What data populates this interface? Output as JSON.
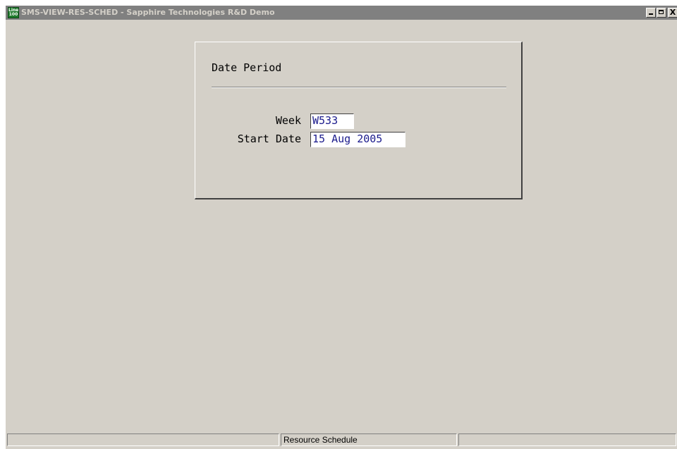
{
  "window": {
    "title": "SMS-VIEW-RES-SCHED - Sapphire Technologies R&D Demo",
    "icon": {
      "name": "line-100-app-icon",
      "text_top": "Line",
      "text_bottom": "100"
    },
    "controls": {
      "minimize_icon": "minimize-icon",
      "maximize_icon": "maximize-icon",
      "close_label": "X"
    }
  },
  "date_period": {
    "title": "Date Period",
    "fields": [
      {
        "label": "Week",
        "value": "W533"
      },
      {
        "label": "Start Date",
        "value": "15 Aug 2005"
      }
    ]
  },
  "statusbar": {
    "cells": [
      "",
      "Resource Schedule",
      ""
    ]
  },
  "colors": {
    "window_bg": "#d4d0c8",
    "titlebar_bg": "#808080",
    "titlebar_text": "#d4d0c8",
    "input_text": "#1a1a8c",
    "input_bg": "#ffffff"
  }
}
